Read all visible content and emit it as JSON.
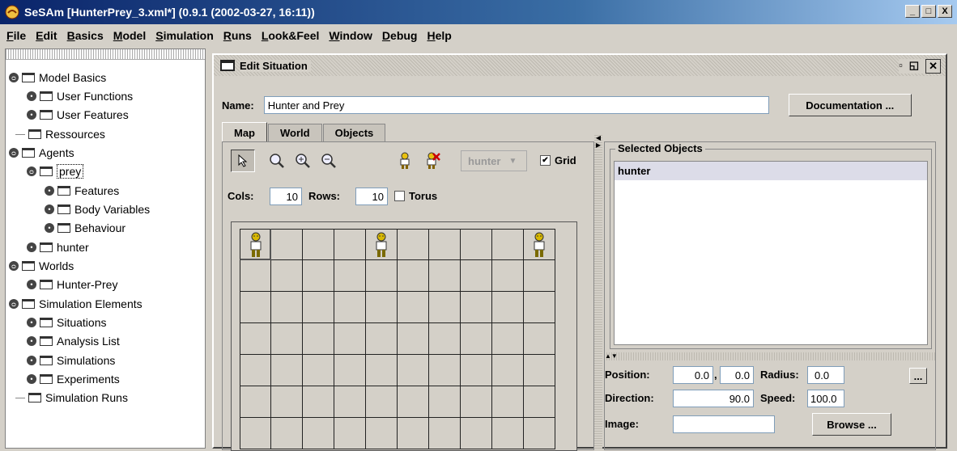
{
  "window": {
    "title": "SeSAm [HunterPrey_3.xml*] (0.9.1 (2002-03-27, 16:11))",
    "controls": [
      "_",
      "□",
      "X"
    ]
  },
  "menu": [
    "File",
    "Edit",
    "Basics",
    "Model",
    "Simulation",
    "Runs",
    "Look&Feel",
    "Window",
    "Debug",
    "Help"
  ],
  "tree": [
    {
      "label": "Model Basics"
    },
    {
      "label": "User Functions"
    },
    {
      "label": "User Features"
    },
    {
      "label": "Ressources"
    },
    {
      "label": "Agents"
    },
    {
      "label": "prey"
    },
    {
      "label": "Features"
    },
    {
      "label": "Body Variables"
    },
    {
      "label": "Behaviour"
    },
    {
      "label": "hunter"
    },
    {
      "label": "Worlds"
    },
    {
      "label": "Hunter-Prey"
    },
    {
      "label": "Simulation Elements"
    },
    {
      "label": "Situations"
    },
    {
      "label": "Analysis List"
    },
    {
      "label": "Simulations"
    },
    {
      "label": "Experiments"
    },
    {
      "label": "Simulation Runs"
    }
  ],
  "edit": {
    "title": "Edit Situation",
    "name_label": "Name:",
    "name_value": "Hunter and Prey",
    "doc_button": "Documentation ...",
    "tabs": [
      "Map",
      "World",
      "Objects"
    ],
    "map": {
      "agent_combo": "hunter",
      "grid_label": "Grid",
      "grid_checked": true,
      "cols_label": "Cols:",
      "cols_value": "10",
      "rows_label": "Rows:",
      "rows_value": "10",
      "torus_label": "Torus",
      "torus_checked": false
    },
    "selected": {
      "title": "Selected Objects",
      "items": [
        "hunter"
      ]
    },
    "props": {
      "position_label": "Position:",
      "pos_x": "0.0",
      "pos_sep": ",",
      "pos_y": "0.0",
      "radius_label": "Radius:",
      "radius": "0.0",
      "more_button": "...",
      "direction_label": "Direction:",
      "direction": "90.0",
      "speed_label": "Speed:",
      "speed": "100.0",
      "image_label": "Image:",
      "image": "",
      "browse_button": "Browse ..."
    }
  }
}
